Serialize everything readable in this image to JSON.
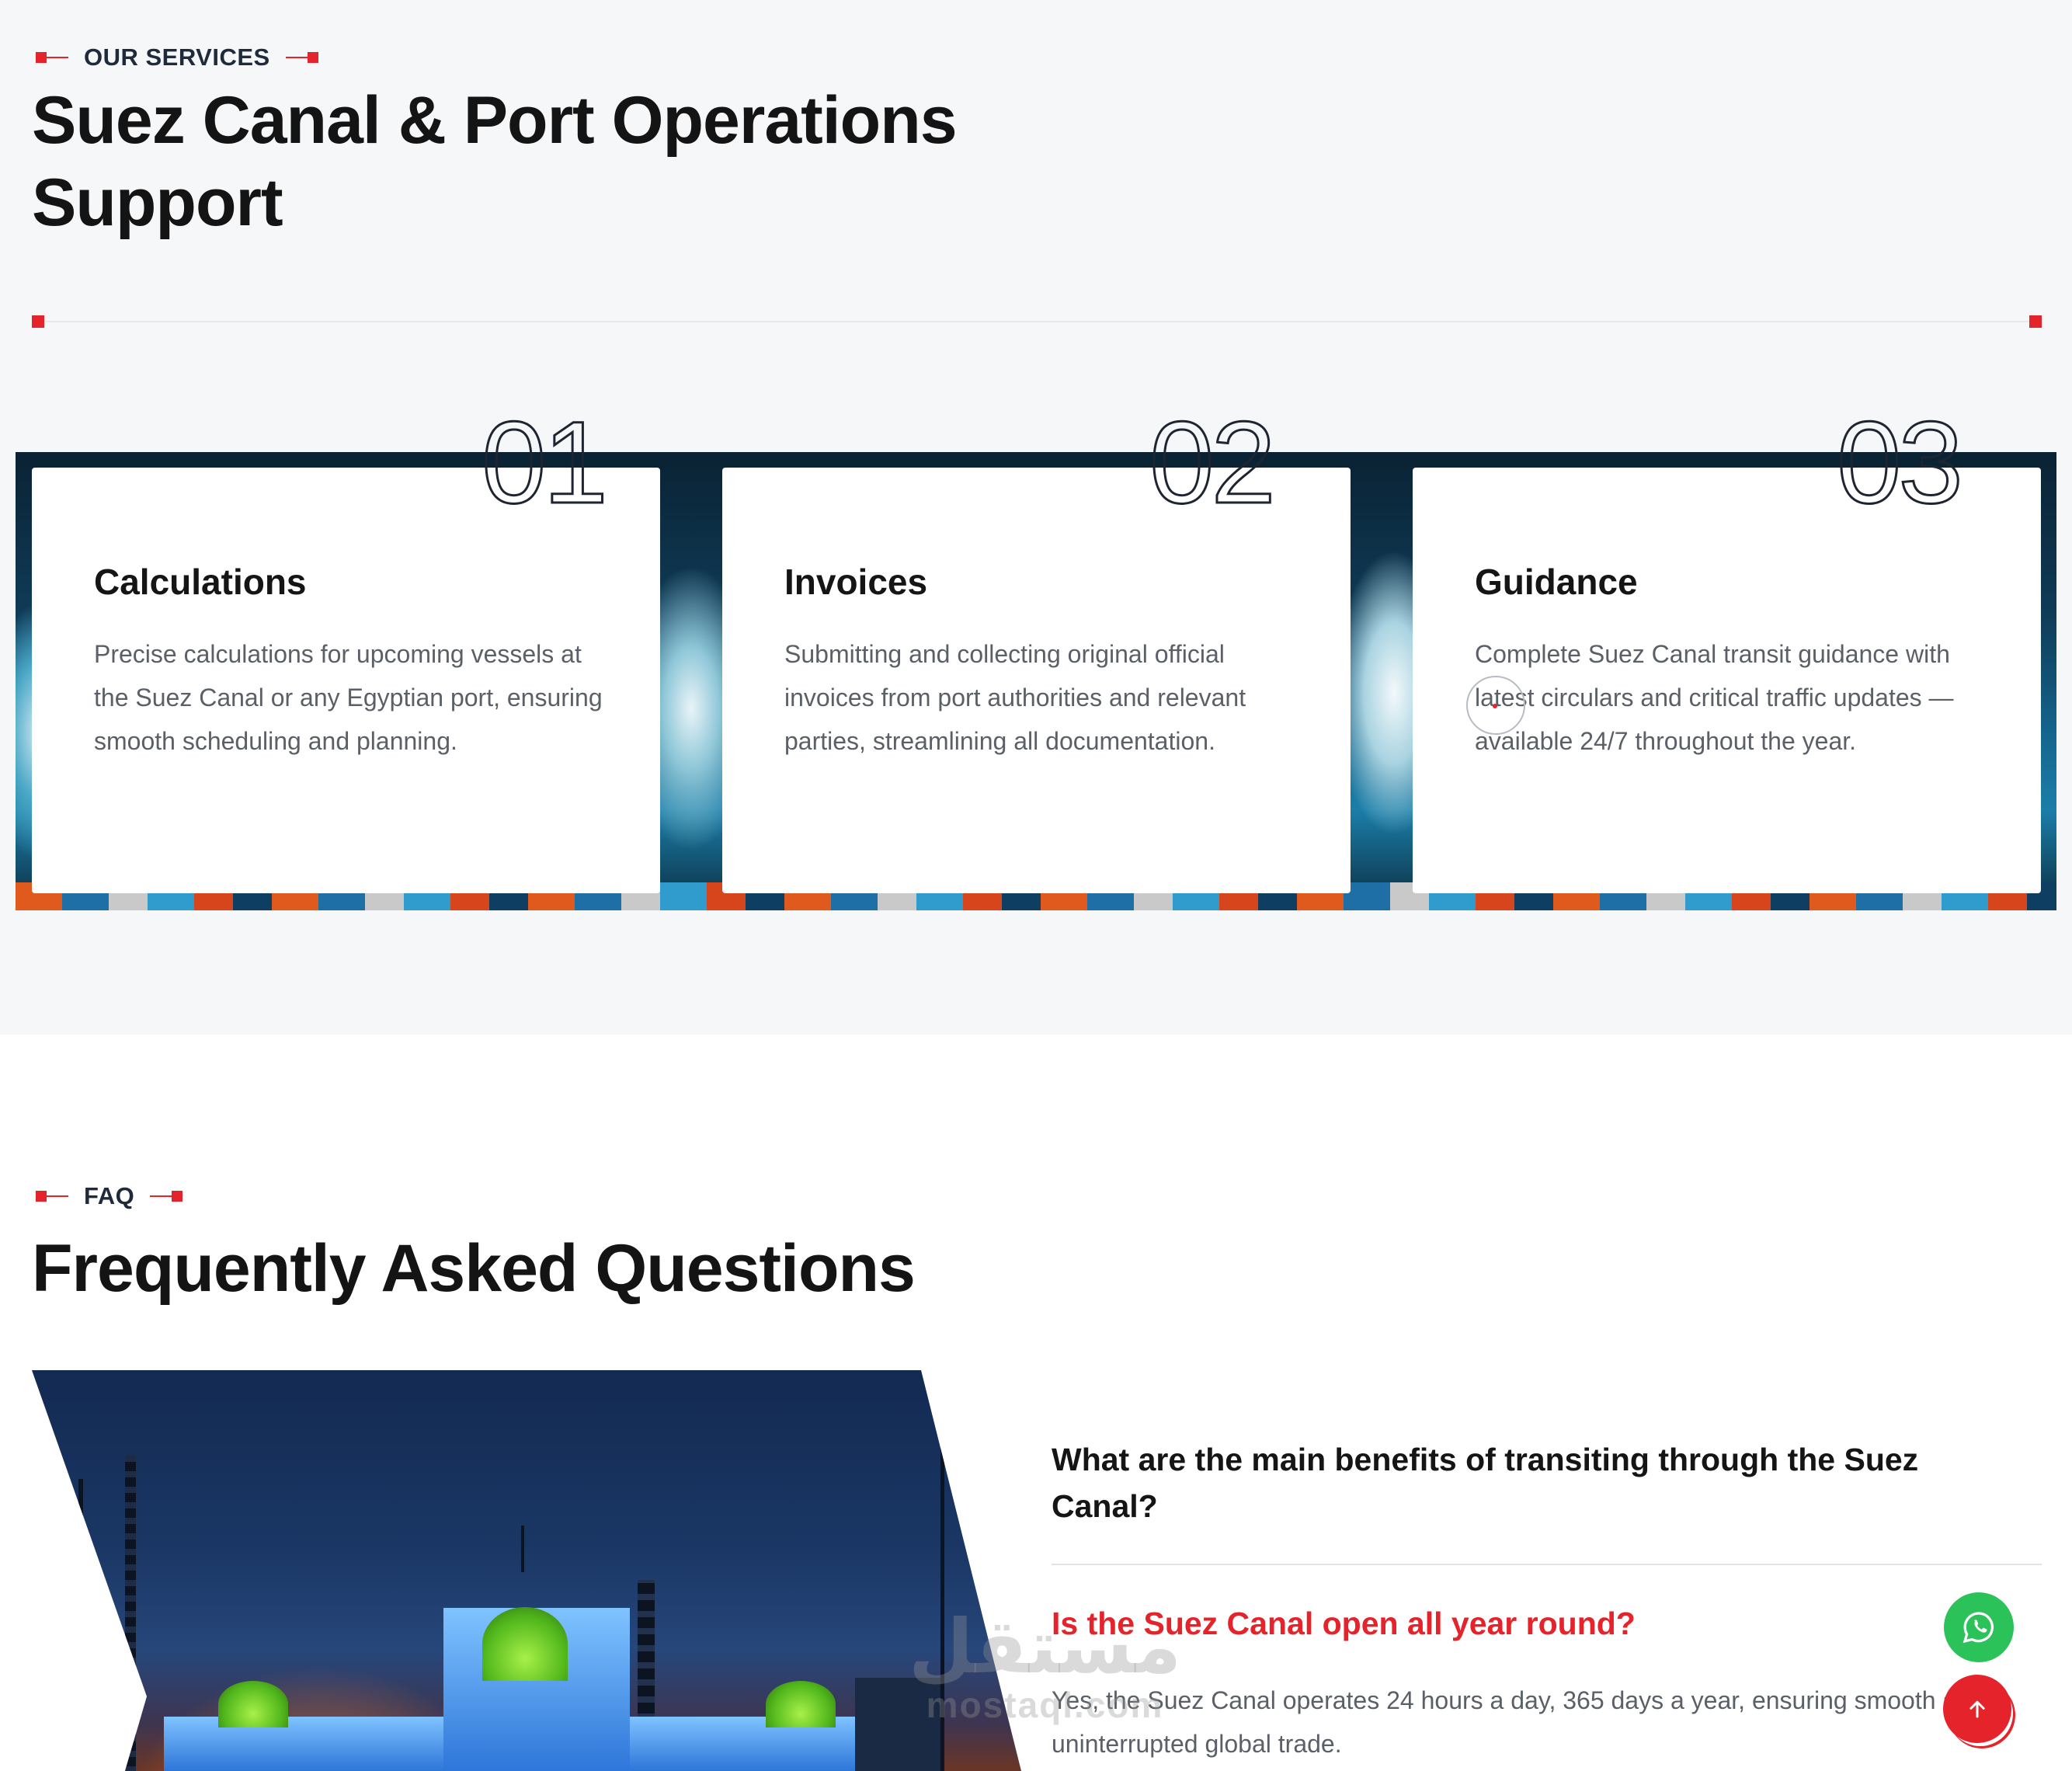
{
  "services": {
    "eyebrow": "OUR SERVICES",
    "title_line1": "Suez Canal & Port Operations",
    "title_line2": "Support",
    "cards": [
      {
        "number": "01",
        "title": "Calculations",
        "description": "Precise calculations for upcoming vessels at the Suez Canal or any Egyptian port, ensuring smooth scheduling and planning."
      },
      {
        "number": "02",
        "title": "Invoices",
        "description": "Submitting and collecting original official invoices from port authorities and relevant parties, streamlining all documentation."
      },
      {
        "number": "03",
        "title": "Guidance",
        "description": "Complete Suez Canal transit guidance with latest circulars and critical traffic updates — available 24/7 throughout the year."
      }
    ]
  },
  "faq": {
    "eyebrow": "FAQ",
    "title": "Frequently Asked Questions",
    "items": [
      {
        "question": "What are the main benefits of transiting through the Suez Canal?",
        "expanded": false
      },
      {
        "question": "Is the Suez Canal open all year round?",
        "expanded": true,
        "answer": "Yes, the Suez Canal operates 24 hours a day, 365 days a year, ensuring smooth and uninterrupted global trade."
      }
    ]
  },
  "watermark": {
    "arabic": "مستقل",
    "latin": "mostaql.com"
  },
  "fabs": {
    "whatsapp_icon": "whatsapp-icon",
    "scroll_top_icon": "arrow-up-icon"
  },
  "colors": {
    "accent": "#e4232a",
    "whatsapp": "#2bc25a",
    "dark": "#141414",
    "muted": "#5b6068"
  }
}
